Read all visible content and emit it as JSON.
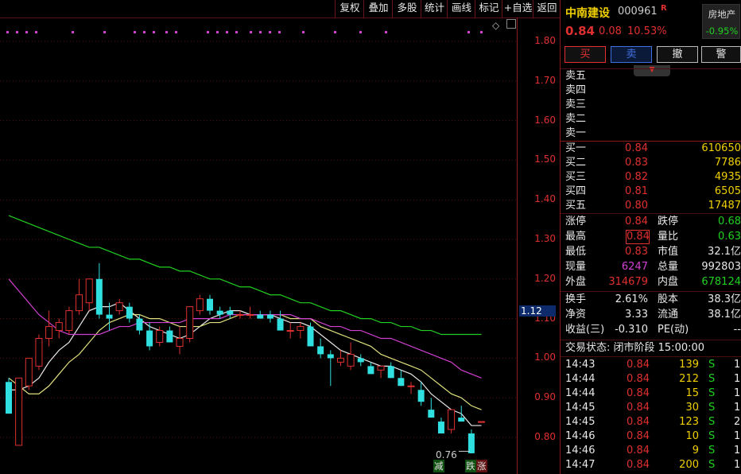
{
  "toolbar": {
    "buttons": [
      "复权",
      "叠加",
      "多股",
      "统计",
      "画线",
      "标记",
      "+自选",
      "返回"
    ]
  },
  "chart": {
    "y_ticks": [
      "1.80",
      "1.70",
      "1.60",
      "1.50",
      "1.40",
      "1.30",
      "1.20",
      "1.10",
      "1.00",
      "0.90",
      "0.80"
    ],
    "current_price_label": "1.12",
    "low_label": "0.76",
    "bottom_tags": [
      "减",
      "跌",
      "涨"
    ],
    "colors": {
      "up": "#e03030",
      "down": "#30e0e0",
      "ma5": "#e8e8e8",
      "ma10": "#e0e080",
      "ma20": "#d040d0",
      "ma60": "#20d020",
      "dot": "#d040d0"
    }
  },
  "chart_data": {
    "type": "candlestick",
    "ylim": [
      0.75,
      1.86
    ],
    "candles": [
      {
        "o": 0.94,
        "h": 0.95,
        "l": 0.86,
        "c": 0.86
      },
      {
        "o": 0.78,
        "h": 0.95,
        "l": 0.78,
        "c": 0.95
      },
      {
        "o": 0.93,
        "h": 1.0,
        "l": 0.92,
        "c": 1.0
      },
      {
        "o": 0.98,
        "h": 1.06,
        "l": 0.97,
        "c": 1.05
      },
      {
        "o": 1.05,
        "h": 1.12,
        "l": 1.03,
        "c": 1.08
      },
      {
        "o": 1.07,
        "h": 1.1,
        "l": 1.05,
        "c": 1.09
      },
      {
        "o": 1.07,
        "h": 1.13,
        "l": 1.06,
        "c": 1.12
      },
      {
        "o": 1.12,
        "h": 1.2,
        "l": 1.11,
        "c": 1.16
      },
      {
        "o": 1.14,
        "h": 1.2,
        "l": 1.12,
        "c": 1.2
      },
      {
        "o": 1.2,
        "h": 1.24,
        "l": 1.1,
        "c": 1.11
      },
      {
        "o": 1.11,
        "h": 1.14,
        "l": 1.07,
        "c": 1.1
      },
      {
        "o": 1.12,
        "h": 1.15,
        "l": 1.11,
        "c": 1.14
      },
      {
        "o": 1.13,
        "h": 1.14,
        "l": 1.09,
        "c": 1.1
      },
      {
        "o": 1.1,
        "h": 1.11,
        "l": 1.06,
        "c": 1.07
      },
      {
        "o": 1.07,
        "h": 1.09,
        "l": 1.02,
        "c": 1.03
      },
      {
        "o": 1.04,
        "h": 1.08,
        "l": 1.03,
        "c": 1.07
      },
      {
        "o": 1.07,
        "h": 1.08,
        "l": 1.04,
        "c": 1.04
      },
      {
        "o": 1.03,
        "h": 1.08,
        "l": 1.01,
        "c": 1.05
      },
      {
        "o": 1.05,
        "h": 1.13,
        "l": 1.04,
        "c": 1.13
      },
      {
        "o": 1.12,
        "h": 1.16,
        "l": 1.11,
        "c": 1.15
      },
      {
        "o": 1.15,
        "h": 1.16,
        "l": 1.11,
        "c": 1.12
      },
      {
        "o": 1.12,
        "h": 1.13,
        "l": 1.1,
        "c": 1.11
      },
      {
        "o": 1.12,
        "h": 1.13,
        "l": 1.1,
        "c": 1.11
      },
      {
        "o": 1.11,
        "h": 1.12,
        "l": 1.1,
        "c": 1.11
      },
      {
        "o": 1.11,
        "h": 1.13,
        "l": 1.1,
        "c": 1.11
      },
      {
        "o": 1.11,
        "h": 1.12,
        "l": 1.1,
        "c": 1.1
      },
      {
        "o": 1.11,
        "h": 1.12,
        "l": 1.09,
        "c": 1.1
      },
      {
        "o": 1.1,
        "h": 1.12,
        "l": 1.07,
        "c": 1.07
      },
      {
        "o": 1.07,
        "h": 1.09,
        "l": 1.05,
        "c": 1.07
      },
      {
        "o": 1.07,
        "h": 1.09,
        "l": 1.05,
        "c": 1.08
      },
      {
        "o": 1.08,
        "h": 1.09,
        "l": 1.03,
        "c": 1.03
      },
      {
        "o": 1.03,
        "h": 1.05,
        "l": 1.0,
        "c": 1.01
      },
      {
        "o": 1.01,
        "h": 1.02,
        "l": 0.93,
        "c": 1.0
      },
      {
        "o": 0.99,
        "h": 1.02,
        "l": 0.98,
        "c": 1.0
      },
      {
        "o": 0.98,
        "h": 1.04,
        "l": 0.97,
        "c": 1.01
      },
      {
        "o": 1.0,
        "h": 1.01,
        "l": 0.98,
        "c": 0.99
      },
      {
        "o": 0.98,
        "h": 0.99,
        "l": 0.96,
        "c": 0.96
      },
      {
        "o": 0.97,
        "h": 0.98,
        "l": 0.95,
        "c": 0.98
      },
      {
        "o": 0.98,
        "h": 0.99,
        "l": 0.95,
        "c": 0.95
      },
      {
        "o": 0.95,
        "h": 0.97,
        "l": 0.93,
        "c": 0.93
      },
      {
        "o": 0.93,
        "h": 0.94,
        "l": 0.91,
        "c": 0.93
      },
      {
        "o": 0.92,
        "h": 0.94,
        "l": 0.88,
        "c": 0.89
      },
      {
        "o": 0.87,
        "h": 0.9,
        "l": 0.85,
        "c": 0.85
      },
      {
        "o": 0.84,
        "h": 0.85,
        "l": 0.81,
        "c": 0.81
      },
      {
        "o": 0.82,
        "h": 0.87,
        "l": 0.81,
        "c": 0.87
      },
      {
        "o": 0.85,
        "h": 0.88,
        "l": 0.84,
        "c": 0.84
      },
      {
        "o": 0.81,
        "h": 0.82,
        "l": 0.76,
        "c": 0.76
      },
      {
        "o": 0.84,
        "h": 0.84,
        "l": 0.84,
        "c": 0.84
      }
    ],
    "ma_lines": [
      {
        "name": "MA5",
        "color": "#e8e8e8",
        "values": [
          0.92,
          0.92,
          0.93,
          0.95,
          0.99,
          1.02,
          1.04,
          1.08,
          1.12,
          1.13,
          1.13,
          1.14,
          1.12,
          1.1,
          1.08,
          1.07,
          1.06,
          1.05,
          1.06,
          1.08,
          1.1,
          1.11,
          1.12,
          1.12,
          1.11,
          1.11,
          1.11,
          1.1,
          1.09,
          1.09,
          1.08,
          1.06,
          1.04,
          1.02,
          1.01,
          1.0,
          0.99,
          0.98,
          0.98,
          0.97,
          0.96,
          0.94,
          0.91,
          0.89,
          0.87,
          0.86,
          0.83,
          0.83
        ]
      },
      {
        "name": "MA10",
        "color": "#e0e080",
        "values": [
          0.95,
          0.93,
          0.91,
          0.91,
          0.93,
          0.96,
          0.99,
          1.01,
          1.04,
          1.07,
          1.09,
          1.1,
          1.11,
          1.11,
          1.1,
          1.1,
          1.09,
          1.08,
          1.08,
          1.08,
          1.09,
          1.09,
          1.1,
          1.11,
          1.11,
          1.11,
          1.11,
          1.11,
          1.1,
          1.1,
          1.1,
          1.08,
          1.07,
          1.06,
          1.05,
          1.04,
          1.03,
          1.01,
          1.0,
          0.99,
          0.98,
          0.97,
          0.95,
          0.93,
          0.91,
          0.9,
          0.88,
          0.87
        ]
      },
      {
        "name": "MA20",
        "color": "#d040d0",
        "values": [
          1.2,
          1.17,
          1.14,
          1.11,
          1.09,
          1.07,
          1.06,
          1.06,
          1.06,
          1.06,
          1.07,
          1.08,
          1.08,
          1.09,
          1.09,
          1.09,
          1.09,
          1.09,
          1.1,
          1.1,
          1.1,
          1.1,
          1.11,
          1.11,
          1.11,
          1.11,
          1.11,
          1.11,
          1.11,
          1.1,
          1.1,
          1.09,
          1.08,
          1.08,
          1.07,
          1.07,
          1.06,
          1.05,
          1.05,
          1.04,
          1.03,
          1.02,
          1.01,
          1.0,
          0.99,
          0.97,
          0.96,
          0.95
        ]
      },
      {
        "name": "MA60",
        "color": "#20d020",
        "values": [
          1.36,
          1.35,
          1.34,
          1.33,
          1.32,
          1.31,
          1.3,
          1.29,
          1.28,
          1.28,
          1.27,
          1.26,
          1.25,
          1.25,
          1.24,
          1.23,
          1.23,
          1.22,
          1.22,
          1.21,
          1.2,
          1.2,
          1.19,
          1.18,
          1.18,
          1.17,
          1.16,
          1.16,
          1.15,
          1.14,
          1.14,
          1.13,
          1.12,
          1.12,
          1.11,
          1.1,
          1.1,
          1.09,
          1.09,
          1.08,
          1.08,
          1.07,
          1.07,
          1.06,
          1.06,
          1.06,
          1.06,
          1.06
        ]
      }
    ]
  },
  "panel": {
    "name": "中南建设",
    "code": "000961",
    "r_mark": "R",
    "sector": "房地产",
    "sector_change": "-0.95%",
    "price": "0.84",
    "change": "0.08",
    "change_pct": "10.53%",
    "buttons": [
      "买",
      "卖",
      "撤",
      "警"
    ],
    "sell_labels": [
      "卖五",
      "卖四",
      "卖三",
      "卖二",
      "卖一"
    ],
    "bids": [
      {
        "label": "买一",
        "price": "0.84",
        "vol": "610650"
      },
      {
        "label": "买二",
        "price": "0.83",
        "vol": "7786"
      },
      {
        "label": "买三",
        "price": "0.82",
        "vol": "4935"
      },
      {
        "label": "买四",
        "price": "0.81",
        "vol": "6505"
      },
      {
        "label": "买五",
        "price": "0.80",
        "vol": "17487"
      }
    ],
    "stats_left": [
      {
        "label": "涨停",
        "value": "0.84"
      },
      {
        "label": "最高",
        "value": "0.84"
      },
      {
        "label": "最低",
        "value": "0.83"
      },
      {
        "label": "现量",
        "value": "6247"
      },
      {
        "label": "外盘",
        "value": "314679"
      }
    ],
    "stats_right": [
      {
        "label": "跌停",
        "value": "0.68"
      },
      {
        "label": "量比",
        "value": "0.63"
      },
      {
        "label": "市值",
        "value": "32.1亿"
      },
      {
        "label": "总量",
        "value": "992803"
      },
      {
        "label": "内盘",
        "value": "678124"
      }
    ],
    "fund_left": [
      {
        "label": "换手",
        "value": "2.61%"
      },
      {
        "label": "净资",
        "value": "3.33"
      },
      {
        "label": "收益(三)",
        "value": "-0.310"
      }
    ],
    "fund_right": [
      {
        "label": "股本",
        "value": "38.3亿"
      },
      {
        "label": "流通",
        "value": "38.1亿"
      },
      {
        "label": "PE(动)",
        "value": "--"
      }
    ],
    "trade_status": "交易状态: 闭市阶段 15:00:00",
    "ticks": [
      {
        "time": "14:43",
        "price": "0.84",
        "vol": "139",
        "side": "S",
        "n": "1"
      },
      {
        "time": "14:44",
        "price": "0.84",
        "vol": "212",
        "side": "S",
        "n": "1"
      },
      {
        "time": "14:44",
        "price": "0.84",
        "vol": "15",
        "side": "S",
        "n": "1"
      },
      {
        "time": "14:45",
        "price": "0.84",
        "vol": "30",
        "side": "S",
        "n": "1"
      },
      {
        "time": "14:45",
        "price": "0.84",
        "vol": "123",
        "side": "S",
        "n": "2"
      },
      {
        "time": "14:46",
        "price": "0.84",
        "vol": "10",
        "side": "S",
        "n": "1"
      },
      {
        "time": "14:46",
        "price": "0.84",
        "vol": "9",
        "side": "S",
        "n": "1"
      },
      {
        "time": "14:47",
        "price": "0.84",
        "vol": "200",
        "side": "S",
        "n": "1"
      }
    ]
  }
}
